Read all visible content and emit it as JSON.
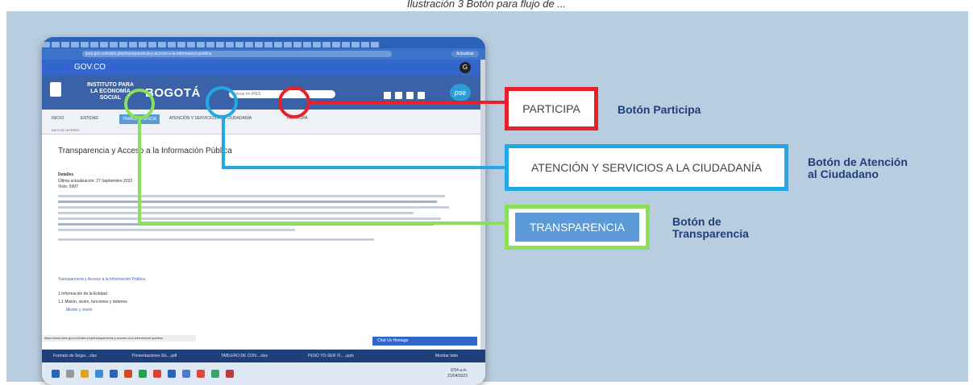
{
  "caption": "Ilustración 3 Botón para flujo de ...",
  "browser": {
    "url": "ipes.gov.co/index.php/transparencia-y-acceso-a-la-informacion-publica",
    "action_label": "Actualizar"
  },
  "gov_bar": {
    "label": "GOV.CO",
    "icon_letter": "G"
  },
  "header": {
    "institute": "INSTITUTO PARA LA ECONOMÍA SOCIAL",
    "city": "BOGOTÁ",
    "search_placeholder": "Buscar en IPES",
    "badge": "pse"
  },
  "nav": {
    "items": [
      "INICIO",
      "ENTIDAD",
      "TRANSPARENCIA",
      "ATENCIÓN Y SERVICIOS A LA CIUDADANÍA",
      "PARTICIPA"
    ],
    "sub": "INFO DE INTERÉS"
  },
  "content": {
    "heading": "Transparencia y Acceso a la Información Pública",
    "detalles": "Detalles",
    "updated": "Última actualización: 27 Septiembre 2022",
    "views": "Visto: 5907",
    "link_box": "Transparencia y Acceso a la Información Pública",
    "item1": "1 Información de la Entidad",
    "item11": "1.1 Misión, visión, funciones y deberes",
    "bullet": "Misión y visión"
  },
  "status_url": "https://www.ipes.gov.co/index.php/transparencia-y-acceso-a-la-informacion-publica",
  "chat_label": "Chat Us Homage",
  "downloads": [
    "Formato de Segui....xlsx",
    "Presentaciones Sis....pdf",
    "TABLERO DE CON....xlsx",
    "PESO YO-SER VI.....pptx"
  ],
  "show_all": "Mostrar todo",
  "clock": {
    "time": "9:54 a.m.",
    "date": "21/04/2023"
  },
  "callouts": {
    "participa": {
      "label": "PARTICIPA",
      "annotation": "Botón Participa",
      "color": "#e8202a"
    },
    "atencion": {
      "label": "ATENCIÓN Y SERVICIOS A LA CIUDADANÍA",
      "annotation_line1": "Botón de Atención",
      "annotation_line2": "al Ciudadano",
      "color": "#22a8e6"
    },
    "transparencia": {
      "label": "TRANSPARENCIA",
      "annotation_line1": "Botón de",
      "annotation_line2": "Transparencia",
      "color": "#8be05a"
    }
  }
}
